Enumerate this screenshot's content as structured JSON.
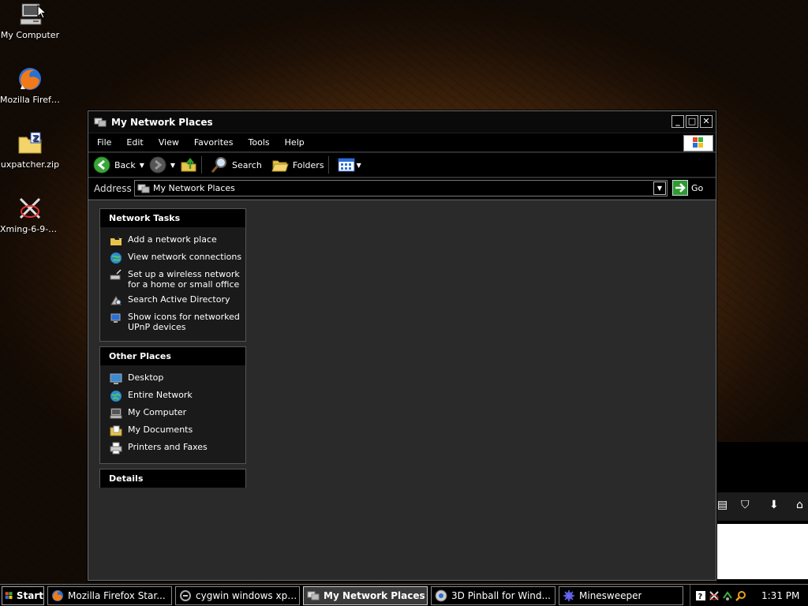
{
  "desktop": {
    "icons": [
      {
        "label": "My Computer",
        "icon": "my-computer-icon"
      },
      {
        "label": "Mozilla Firefox",
        "icon": "firefox-icon"
      },
      {
        "label": "uxpatcher.zip",
        "icon": "zip-folder-icon"
      },
      {
        "label": "Xming-6-9-0-...",
        "icon": "xming-icon"
      }
    ]
  },
  "window": {
    "title": "My Network Places",
    "menu": [
      "File",
      "Edit",
      "View",
      "Favorites",
      "Tools",
      "Help"
    ],
    "toolbar": {
      "back": "Back",
      "search": "Search",
      "folders": "Folders"
    },
    "address": {
      "label": "Address",
      "value": "My Network Places",
      "go": "Go"
    },
    "panels": {
      "network_tasks": {
        "title": "Network Tasks",
        "items": [
          {
            "label": "Add a network place",
            "icon": "add-network-place-icon"
          },
          {
            "label": "View network connections",
            "icon": "network-connections-icon"
          },
          {
            "label": "Set up a wireless network for a home or small office",
            "icon": "wireless-icon"
          },
          {
            "label": "Search Active Directory",
            "icon": "active-directory-icon"
          },
          {
            "label": "Show icons for networked UPnP devices",
            "icon": "upnp-icon"
          }
        ]
      },
      "other_places": {
        "title": "Other Places",
        "items": [
          {
            "label": "Desktop",
            "icon": "desktop-icon"
          },
          {
            "label": "Entire Network",
            "icon": "entire-network-icon"
          },
          {
            "label": "My Computer",
            "icon": "my-computer-icon"
          },
          {
            "label": "My Documents",
            "icon": "my-documents-icon"
          },
          {
            "label": "Printers and Faxes",
            "icon": "printer-icon"
          }
        ]
      },
      "details": {
        "title": "Details"
      }
    }
  },
  "taskbar": {
    "start": "Start",
    "tasks": [
      {
        "label": "Mozilla Firefox Star...",
        "icon": "firefox-icon",
        "active": false
      },
      {
        "label": "cygwin windows xp ...",
        "icon": "cygwin-icon",
        "active": false
      },
      {
        "label": "My Network Places",
        "icon": "network-places-icon",
        "active": true
      },
      {
        "label": "3D Pinball for Wind...",
        "icon": "pinball-icon",
        "active": false
      },
      {
        "label": "Minesweeper",
        "icon": "minesweeper-icon",
        "active": false
      }
    ],
    "clock": "1:31 PM"
  },
  "colors": {
    "window_bg": "#2a2a2a",
    "panel_bg": "#1a1a1a",
    "titlebar": "#0a0a0a",
    "go_green": "#2f9a2f"
  }
}
